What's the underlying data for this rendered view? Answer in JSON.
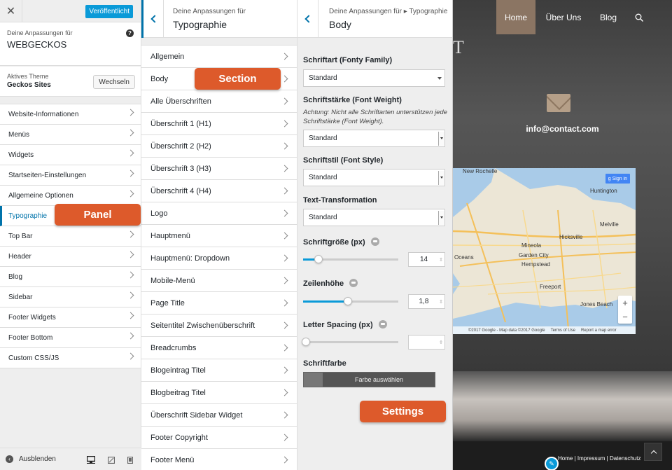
{
  "panel1": {
    "publish_label": "Veröffentlicht",
    "info_label": "Deine Anpassungen für",
    "site_name": "WEBGECKOS",
    "theme_label": "Aktives Theme",
    "theme_name": "Geckos Sites",
    "theme_button": "Wechseln",
    "menu": [
      {
        "label": "Website-Informationen"
      },
      {
        "label": "Menüs"
      },
      {
        "label": "Widgets"
      },
      {
        "label": "Startseiten-Einstellungen"
      },
      {
        "label": "Allgemeine Optionen"
      },
      {
        "label": "Typographie",
        "active": true
      },
      {
        "label": "Top Bar"
      },
      {
        "label": "Header"
      },
      {
        "label": "Blog"
      },
      {
        "label": "Sidebar"
      },
      {
        "label": "Footer Widgets"
      },
      {
        "label": "Footer Bottom"
      },
      {
        "label": "Custom CSS/JS"
      }
    ],
    "hide_label": "Ausblenden"
  },
  "panel2": {
    "subtitle": "Deine Anpassungen für",
    "title": "Typographie",
    "items": [
      "Allgemein",
      "Body",
      "Alle Überschriften",
      "Überschrift 1 (H1)",
      "Überschrift 2 (H2)",
      "Überschrift 3 (H3)",
      "Überschrift 4 (H4)",
      "Logo",
      "Hauptmenü",
      "Hauptmenü: Dropdown",
      "Mobile-Menü",
      "Page Title",
      "Seitentitel Zwischenüberschrift",
      "Breadcrumbs",
      "Blogeintrag Titel",
      "Blogbeitrag Titel",
      "Überschrift Sidebar Widget",
      "Footer Copyright",
      "Footer Menü"
    ]
  },
  "panel3": {
    "subtitle": "Deine Anpassungen für ▸ Typographie",
    "title": "Body",
    "font_family": {
      "label": "Schriftart (Fonty Family)",
      "value": "Standard"
    },
    "font_weight": {
      "label": "Schriftstärke (Font Weight)",
      "note": "Achtung: Nicht alle Schriftarten unterstützen jede Schriftstärke (Font Weight).",
      "value": "Standard"
    },
    "font_style": {
      "label": "Schriftstil (Font Style)",
      "value": "Standard"
    },
    "text_transform": {
      "label": "Text-Transformation",
      "value": "Standard"
    },
    "font_size": {
      "label": "Schriftgröße (px)",
      "value": "14",
      "level": 0.16
    },
    "line_height": {
      "label": "Zeilenhöhe",
      "value": "1,8",
      "level": 0.47
    },
    "letter_spacing": {
      "label": "Letter Spacing (px)",
      "value": "",
      "level": 0.0
    },
    "font_color": {
      "label": "Schriftfarbe",
      "button": "Farbe auswählen"
    }
  },
  "preview": {
    "nav": [
      "Home",
      "Über Uns",
      "Blog"
    ],
    "email": "info@contact.com",
    "map": {
      "signin": "Sign in",
      "labels": [
        "New Rochelle",
        "Huntington",
        "Melville",
        "Hicksville",
        "Mineola",
        "Garden City",
        "Hempstead",
        "Freeport",
        "Jones Beach",
        "Oceans"
      ],
      "attribution": [
        "©2017 Google - Map data ©2017 Google",
        "Terms of Use",
        "Report a map error"
      ]
    },
    "footer_links": [
      "Home",
      "Impressum",
      "Datenschutz"
    ]
  },
  "callouts": {
    "section": "Section",
    "panel": "Panel",
    "settings": "Settings"
  },
  "colors": {
    "accent": "#0073aa",
    "callout": "#dd5a2b",
    "publish": "#0a9ad8",
    "nav_active": "#8b7563"
  }
}
